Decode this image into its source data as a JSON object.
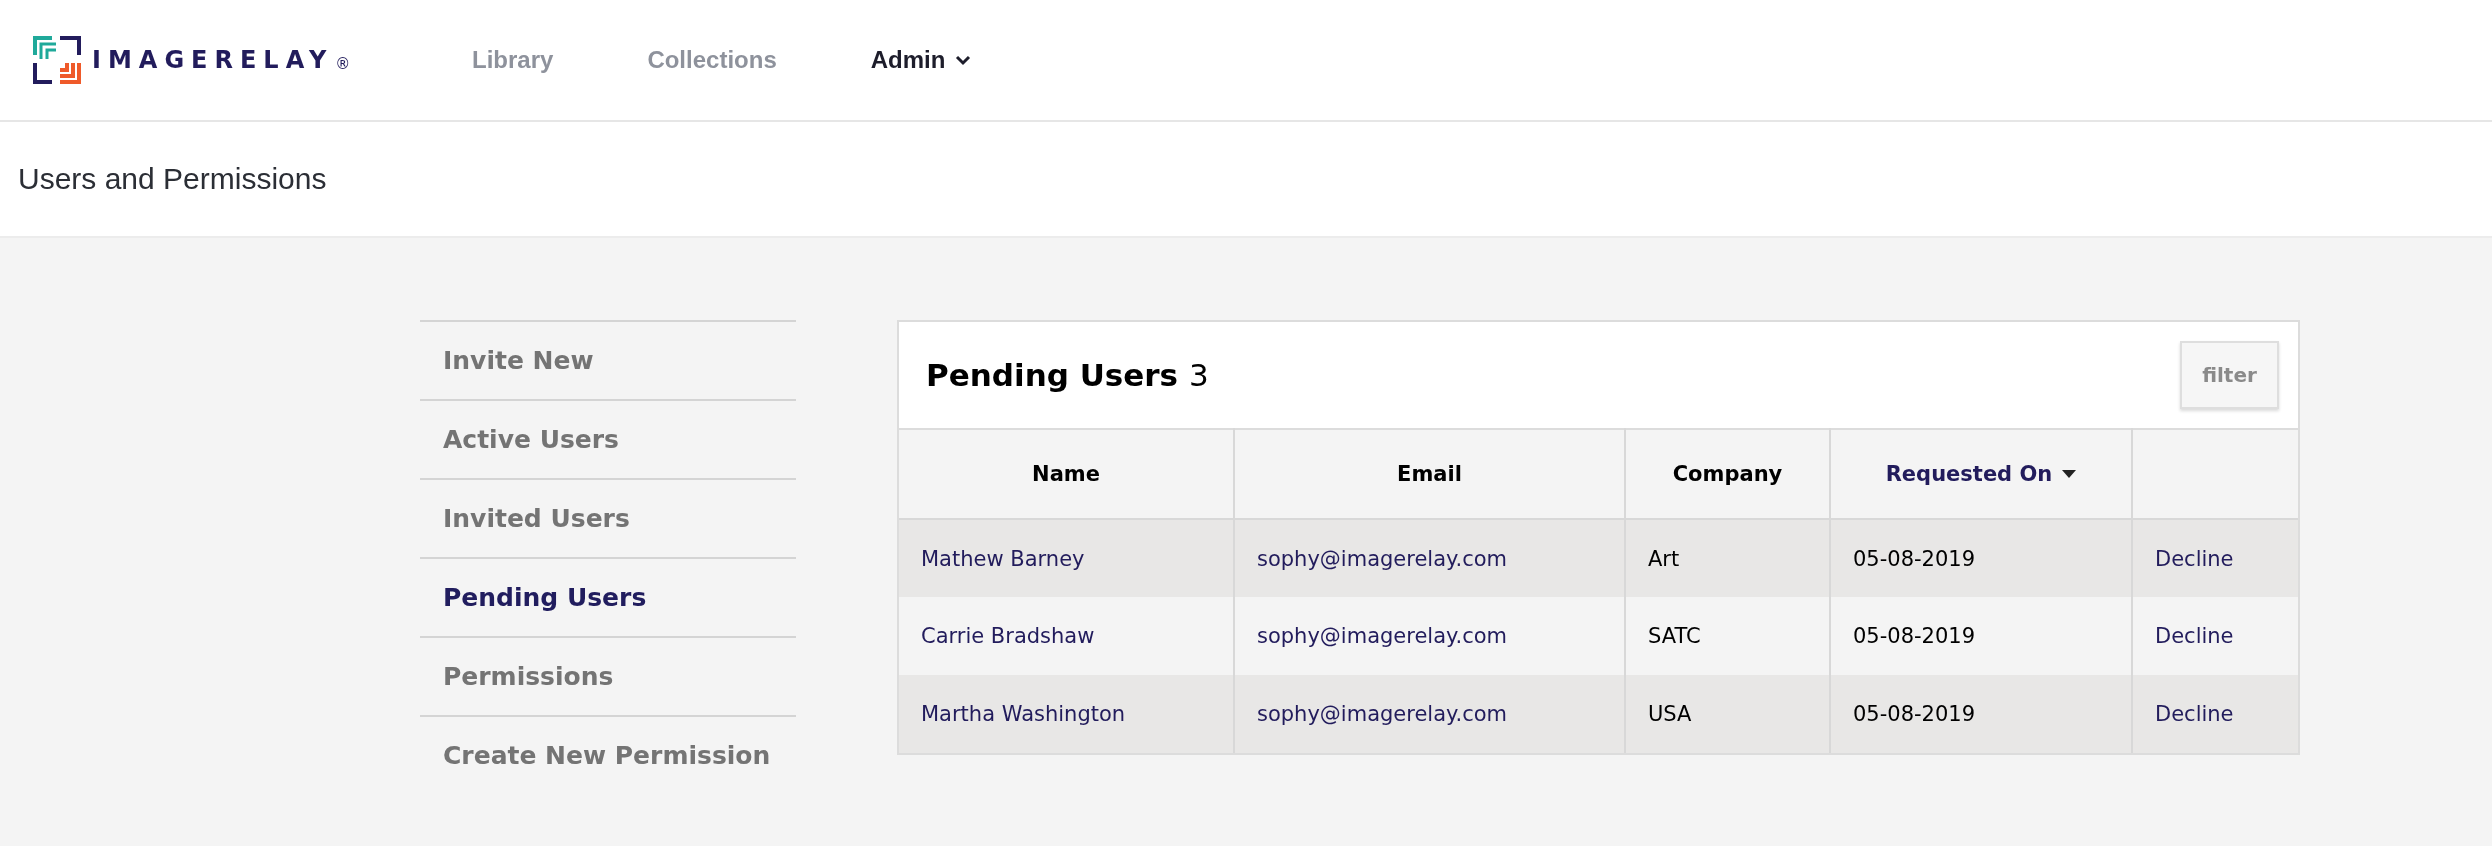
{
  "brand": {
    "name": "IMAGERELAY",
    "mark": "®"
  },
  "nav": [
    {
      "label": "Library",
      "selected": false,
      "dropdown": false
    },
    {
      "label": "Collections",
      "selected": false,
      "dropdown": false
    },
    {
      "label": "Admin",
      "selected": true,
      "dropdown": true
    }
  ],
  "page_title": "Users and Permissions",
  "sidebar": {
    "items": [
      {
        "label": "Invite New",
        "selected": false
      },
      {
        "label": "Active Users",
        "selected": false
      },
      {
        "label": "Invited Users",
        "selected": false
      },
      {
        "label": "Pending Users",
        "selected": true
      },
      {
        "label": "Permissions",
        "selected": false
      },
      {
        "label": "Create New Permission",
        "selected": false
      }
    ]
  },
  "panel": {
    "title": "Pending Users",
    "count": "3",
    "filter_button": "filter",
    "columns": [
      {
        "label": "Name",
        "sorted": false
      },
      {
        "label": "Email",
        "sorted": false
      },
      {
        "label": "Company",
        "sorted": false
      },
      {
        "label": "Requested On",
        "sorted": true
      },
      {
        "sorted": false
      }
    ],
    "rows": [
      {
        "name": "Mathew Barney",
        "email": "sophy@imagerelay.com",
        "company": "Art",
        "requested_on": "05-08-2019",
        "action": "Decline"
      },
      {
        "name": "Carrie Bradshaw",
        "email": "sophy@imagerelay.com",
        "company": "SATC",
        "requested_on": "05-08-2019",
        "action": "Decline"
      },
      {
        "name": "Martha Washington",
        "email": "sophy@imagerelay.com",
        "company": "USA",
        "requested_on": "05-08-2019",
        "action": "Decline"
      }
    ]
  }
}
